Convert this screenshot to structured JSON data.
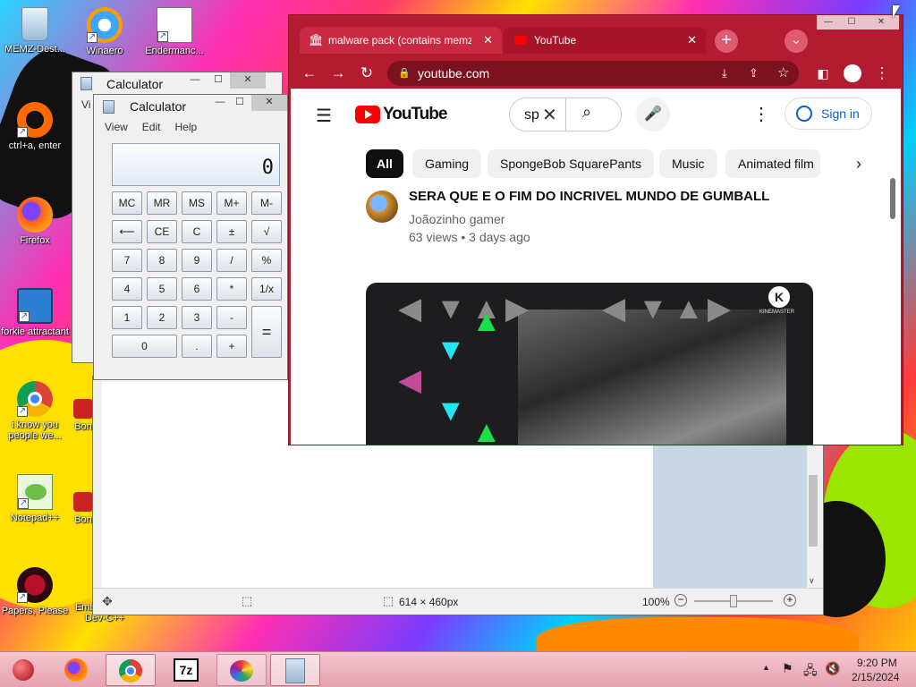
{
  "desktop": {
    "icons": [
      {
        "label": "MEMZ-Dest...",
        "icon": "recycle-bin-icon"
      },
      {
        "label": "Winaero",
        "icon": "winaero-icon"
      },
      {
        "label": "Endermanc...",
        "icon": "document-icon"
      },
      {
        "label": "ctrl+a, enter",
        "icon": "orange-circle-icon"
      },
      {
        "label": "Firefox",
        "icon": "firefox-icon"
      },
      {
        "label": "forkie attractant",
        "icon": "monitor-gear-icon"
      },
      {
        "label": "i know you people we...",
        "icon": "chrome-icon"
      },
      {
        "label": "Bon",
        "icon": "app-icon"
      },
      {
        "label": "Notepad++",
        "icon": "notepadpp-icon"
      },
      {
        "label": "Bon",
        "icon": "app-icon"
      },
      {
        "label": "Papers, Please",
        "icon": "papers-please-icon"
      },
      {
        "label": "Embarcadero Dev-C++",
        "icon": "devcpp-icon"
      }
    ]
  },
  "calculator_back": {
    "title": "Calculator",
    "menu_first": "Vi",
    "buttons": {
      "minimize": "—",
      "maximize": "☐",
      "close": "✕"
    }
  },
  "calculator": {
    "title": "Calculator",
    "menu": [
      "View",
      "Edit",
      "Help"
    ],
    "display": "0",
    "buttons": {
      "minimize": "—",
      "maximize": "☐",
      "close": "✕"
    },
    "keys": {
      "mc": "MC",
      "mr": "MR",
      "ms": "MS",
      "mplus": "M+",
      "mminus": "M-",
      "back": "⟵",
      "ce": "CE",
      "c": "C",
      "pm": "±",
      "sqrt": "√",
      "k7": "7",
      "k8": "8",
      "k9": "9",
      "div": "/",
      "pct": "%",
      "k4": "4",
      "k5": "5",
      "k6": "6",
      "mul": "*",
      "recip": "1/x",
      "k1": "1",
      "k2": "2",
      "k3": "3",
      "sub": "-",
      "eq": "=",
      "k0": "0",
      "dot": ".",
      "add": "+"
    }
  },
  "paint": {
    "status": {
      "size": "614 × 460px",
      "zoom": "100%"
    }
  },
  "chrome": {
    "tabs": [
      {
        "title": "malware pack (contains memz...",
        "close": "✕"
      },
      {
        "title": "YouTube",
        "close": "✕"
      }
    ],
    "new_tab": "+",
    "tab_search": "⌄",
    "window_buttons": {
      "minimize": "—",
      "maximize": "☐",
      "close": "✕"
    },
    "url": "youtube.com",
    "youtube": {
      "logo_text": "YouTube",
      "search_value": "sp",
      "sign_in": "Sign in",
      "chips": [
        "All",
        "Gaming",
        "SpongeBob SquarePants",
        "Music",
        "Animated film"
      ],
      "video": {
        "title": "SERA QUE E O FIM DO INCRIVEL MUNDO DE GUMBALL",
        "channel": "Joãozinho gamer",
        "meta": "63 views • 3 days ago",
        "watermark": "KINEMASTER"
      }
    }
  },
  "taskbar": {
    "clock_time": "9:20 PM",
    "clock_date": "2/15/2024",
    "apps": [
      "ruby-icon",
      "firefox-icon",
      "chrome-icon",
      "7zip-icon",
      "paint-icon",
      "calculator-icon"
    ],
    "sevenzip_label": "7z"
  }
}
